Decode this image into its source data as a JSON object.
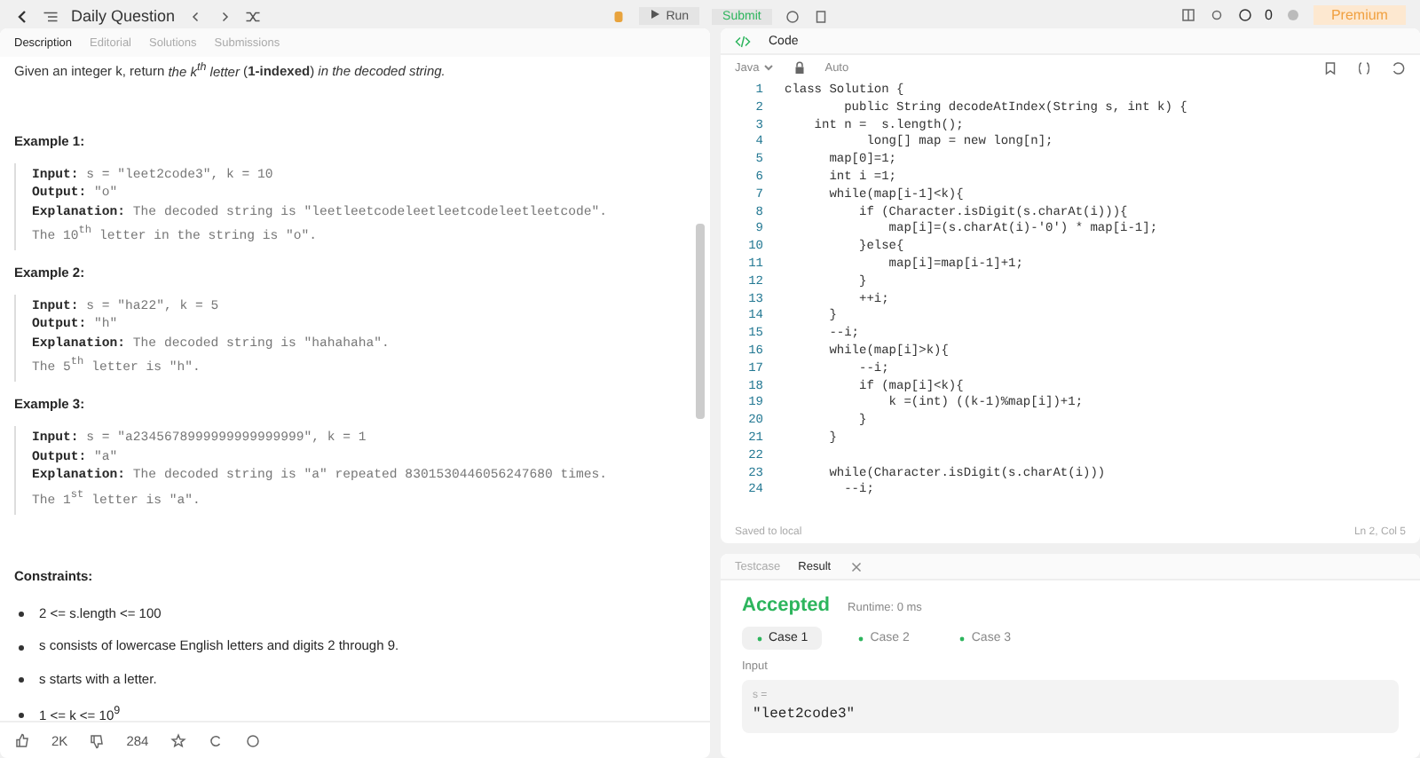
{
  "topbar": {
    "title": "Daily Question",
    "run": "Run",
    "submit": "Submit",
    "streak": "0",
    "premium": "Premium"
  },
  "left_tabs": [
    {
      "label": "Description",
      "selected": true
    },
    {
      "label": "Editorial",
      "selected": false
    },
    {
      "label": "Solutions",
      "selected": false
    },
    {
      "label": "Submissions",
      "selected": false
    }
  ],
  "description": "Given an integer k, return *the k$^{th}$ letter* (**1-indexed**) *in the decoded string.*",
  "examples": [
    {
      "title": "Example 1:",
      "input": "**Input:** s = \"leet2code3\", k = 10",
      "output": "**Output:** \"o\"",
      "explanation": "**Explanation:** The decoded string is \"leetleetcodeleetleetcodeleetleetcode\".",
      "note": "The 10$^{th}$ letter in the string is \"o\"."
    },
    {
      "title": "Example 2:",
      "input": "**Input:** s = \"ha22\", k = 5",
      "output": "**Output:** \"h\"",
      "explanation": "**Explanation:** The decoded string is \"hahahaha\".",
      "note": "The 5$^{th}$ letter is \"h\"."
    },
    {
      "title": "Example 3:",
      "input": "**Input:** s = \"a2345678999999999999999\", k = 1",
      "output": "**Output:** \"a\"",
      "explanation": "**Explanation:** The decoded string is \"a\" repeated 8301530446056247680 times.",
      "note": "The 1$^{st}$ letter is \"a\"."
    }
  ],
  "constraints_title": "Constraints:",
  "constraints": [
    "2 <= s.length <= 100",
    "s consists of lowercase English letters and digits 2 through 9.",
    "s starts with a letter.",
    "1 <= k <= 10$^{9}$"
  ],
  "footer": {
    "likes": "2K",
    "dislikes": "284"
  },
  "code_panel": {
    "title": "Code",
    "language": "Java",
    "mode": "Auto",
    "status": "Saved to local",
    "cursor": "Ln 2, Col 5"
  },
  "code_lines": [
    {
      "no": "1",
      "text": "class Solution {"
    },
    {
      "no": "2",
      "text": "        public String decodeAtIndex(String s, int k) {"
    },
    {
      "no": "3",
      "text": "    int n =  s.length();"
    },
    {
      "no": "4",
      "text": "           long[] map = new long[n];"
    },
    {
      "no": "5",
      "text": "      map[0]=1;"
    },
    {
      "no": "6",
      "text": "      int i =1;"
    },
    {
      "no": "7",
      "text": "      while(map[i-1]<k){"
    },
    {
      "no": "8",
      "text": "          if (Character.isDigit(s.charAt(i))){"
    },
    {
      "no": "9",
      "text": "              map[i]=(s.charAt(i)-'0') * map[i-1];"
    },
    {
      "no": "10",
      "text": "          }else{"
    },
    {
      "no": "11",
      "text": "              map[i]=map[i-1]+1;"
    },
    {
      "no": "12",
      "text": "          }"
    },
    {
      "no": "13",
      "text": "          ++i;"
    },
    {
      "no": "14",
      "text": "      }"
    },
    {
      "no": "15",
      "text": "      --i;"
    },
    {
      "no": "16",
      "text": "      while(map[i]>k){"
    },
    {
      "no": "17",
      "text": "          --i;"
    },
    {
      "no": "18",
      "text": "          if (map[i]<k){"
    },
    {
      "no": "19",
      "text": "              k =(int) ((k-1)%map[i])+1;"
    },
    {
      "no": "20",
      "text": "          }"
    },
    {
      "no": "21",
      "text": "      }"
    },
    {
      "no": "22"
    },
    {
      "no": "23",
      "text": "      while(Character.isDigit(s.charAt(i)))"
    },
    {
      "no": "24",
      "text": "        --i;"
    }
  ],
  "result_tabs": [
    {
      "label": "Testcase",
      "selected": false
    },
    {
      "label": "Result",
      "selected": true
    }
  ],
  "result": {
    "verdict": "Accepted",
    "runtime": "Runtime: 0 ms",
    "input_label": "Input",
    "var": "s =",
    "value": "\"leet2code3\""
  },
  "cases": [
    {
      "label": "Case 1",
      "selected": true
    },
    {
      "label": "Case 2",
      "selected": false
    },
    {
      "label": "Case 3",
      "selected": false
    }
  ]
}
